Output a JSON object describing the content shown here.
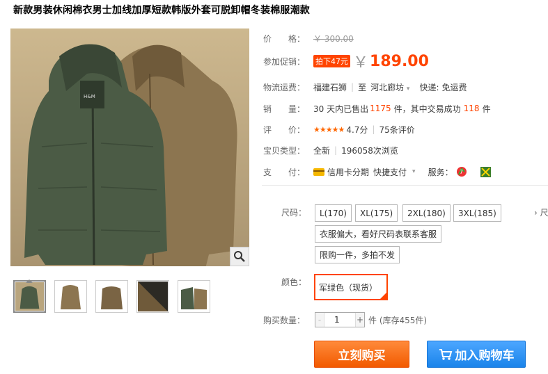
{
  "title": "新款男装休闲棉衣男士加线加厚短款韩版外套可脱卸帽冬装棉服潮款",
  "price": {
    "label": "价　　格：",
    "original": "￥ 300.00"
  },
  "promo": {
    "label": "参加促销：",
    "tag": "拍下47元",
    "yen": "￥",
    "price": "189.00"
  },
  "shipping": {
    "label": "物流运费：",
    "from": "福建石狮",
    "to_label": "至",
    "to": "河北廊坊",
    "express_label": "快递:",
    "express_value": "免运费"
  },
  "sales": {
    "label": "销　　量：",
    "prefix": "30 天内已售出",
    "sold": "1175",
    "mid": "件，其中交易成功",
    "success": "118",
    "suffix": "件"
  },
  "rating": {
    "label": "评　　价：",
    "stars": "★★★★★",
    "score": "4.7分",
    "reviews": "75条评价"
  },
  "type": {
    "label": "宝贝类型：",
    "condition": "全新",
    "views": "196058次浏览"
  },
  "payment": {
    "label": "支　　付：",
    "credit": "信用卡分期",
    "fast": "快捷支付",
    "service_label": "服务："
  },
  "size": {
    "label": "尺码：",
    "options": [
      "L(170)",
      "XL(175)",
      "2XL(180)",
      "3XL(185)"
    ],
    "more": "› 尺",
    "note1": "衣服偏大，看好尺码表联系客服",
    "note2": "限购一件，多拍不发"
  },
  "color": {
    "label": "颜色：",
    "selected": "军绿色（现货）"
  },
  "quantity": {
    "label": "购买数量：",
    "minus": "-",
    "value": "1",
    "plus": "+",
    "stock": "件 (库存455件)"
  },
  "buttons": {
    "buy": "立刻购买",
    "cart": "加入购物车"
  },
  "colors": {
    "accent": "#ff4400",
    "buy": "#f25a00",
    "cart": "#1a84ea",
    "jacket_green": "#4b5b45",
    "jacket_khaki": "#8c7550"
  }
}
